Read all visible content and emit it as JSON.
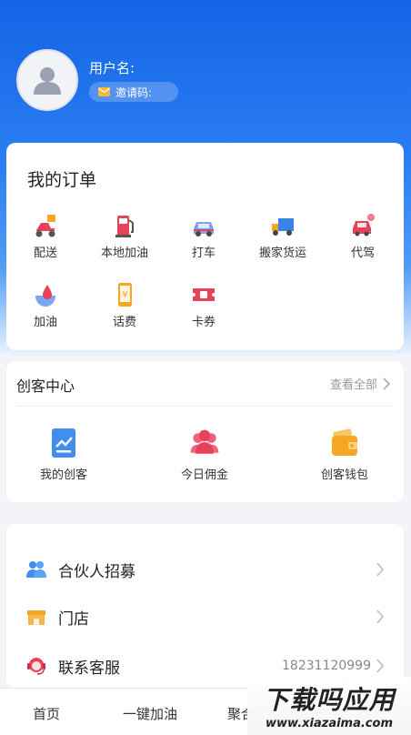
{
  "profile": {
    "username_label": "用户名:",
    "invite_label": "邀请码:"
  },
  "orders": {
    "title": "我的订单",
    "items": [
      {
        "label": "配送",
        "icon": "delivery-scooter-icon"
      },
      {
        "label": "本地加油",
        "icon": "fuel-pump-icon"
      },
      {
        "label": "打车",
        "icon": "taxi-car-icon"
      },
      {
        "label": "搬家货运",
        "icon": "moving-truck-icon"
      },
      {
        "label": "代驾",
        "icon": "designated-driver-icon"
      },
      {
        "label": "加油",
        "icon": "fuel-drop-icon"
      },
      {
        "label": "话费",
        "icon": "phone-bill-icon"
      },
      {
        "label": "卡券",
        "icon": "coupon-icon"
      }
    ]
  },
  "creator_center": {
    "title": "创客中心",
    "view_all": "查看全部",
    "items": [
      {
        "label": "我的创客",
        "icon": "chart-document-icon"
      },
      {
        "label": "今日佣金",
        "icon": "people-group-icon"
      },
      {
        "label": "创客钱包",
        "icon": "wallet-icon"
      }
    ]
  },
  "menu": [
    {
      "label": "合伙人招募",
      "icon": "partner-recruit-icon"
    },
    {
      "label": "门店",
      "icon": "store-icon"
    },
    {
      "label": "联系客服",
      "icon": "customer-service-icon",
      "value": "18231120999"
    }
  ],
  "tabbar": {
    "tabs": [
      {
        "label": "首页"
      },
      {
        "label": "一键加油"
      },
      {
        "label": "聚合"
      }
    ]
  },
  "watermark": {
    "big": "下载吗应用",
    "small": "www.xiazaima.com"
  },
  "colors": {
    "brand_blue": "#1464e6",
    "accent_red": "#e8415a",
    "accent_orange": "#f5a623"
  }
}
